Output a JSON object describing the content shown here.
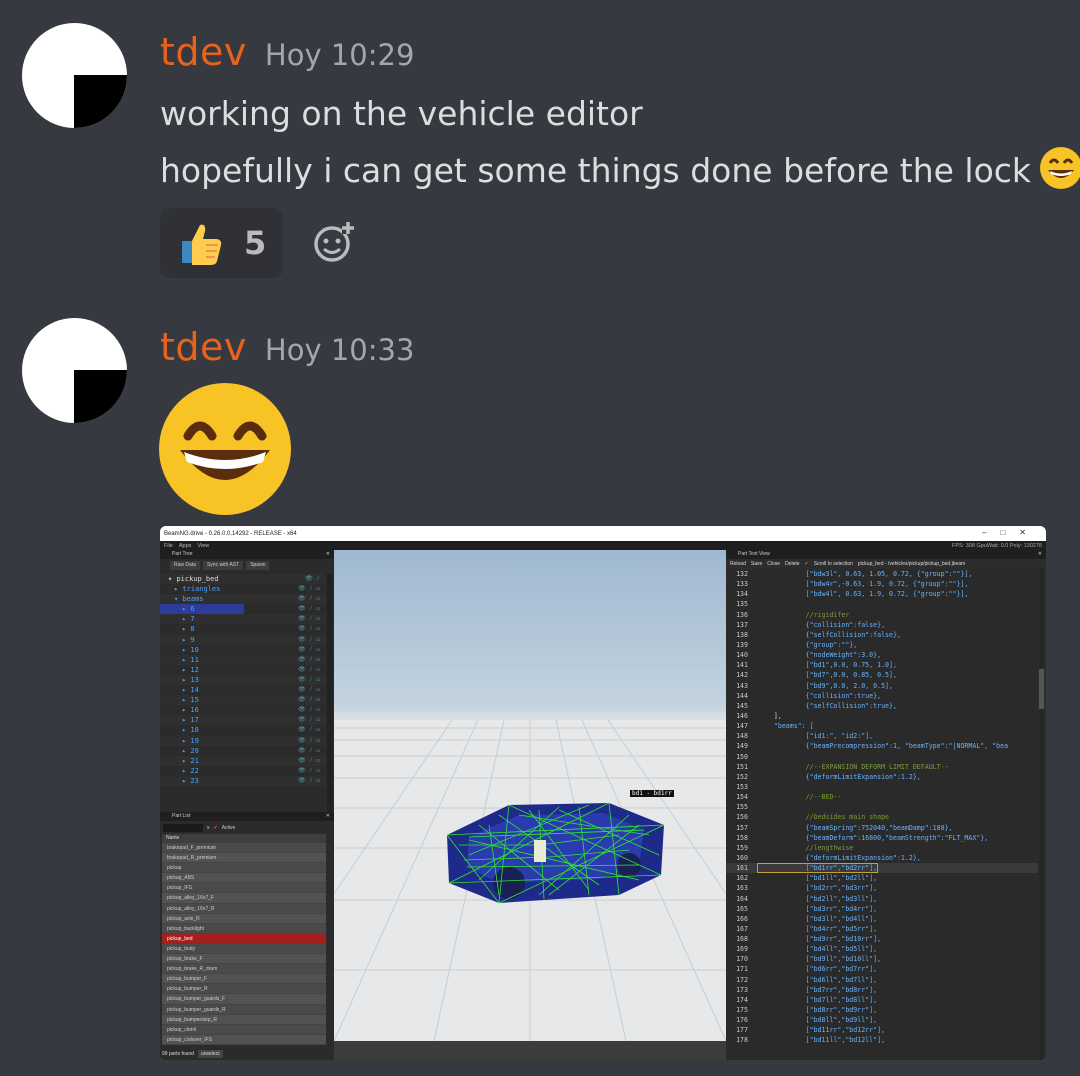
{
  "messages": [
    {
      "username": "tdev",
      "timestamp": "Hoy 10:29",
      "lines": [
        "working on the vehicle editor",
        "hopefully i can get some things done before the lock"
      ],
      "reaction": {
        "emoji": "thumbs-up",
        "count": "5"
      }
    },
    {
      "username": "tdev",
      "timestamp": "Hoy 10:33"
    }
  ],
  "screenshot": {
    "title": "BeamNG.drive - 0.26.0.0.14292 - RELEASE - x64",
    "menu": [
      "File",
      "Apps",
      "View"
    ],
    "fps_text": "FPS: 308  GpuWait: 0.0  Poly: 130278",
    "part_tree": {
      "title": "Part Tree",
      "tabs": [
        "Raw Data",
        "Sync with AST",
        "Spawn"
      ],
      "root": "▾ pickup_bed",
      "items": [
        "▸ triangles",
        "▾ beams",
        "▸ 6",
        "▸ 7",
        "▸ 8",
        "▸ 9",
        "▸ 10",
        "▸ 11",
        "▸ 12",
        "▸ 13",
        "▸ 14",
        "▸ 15",
        "▸ 16",
        "▸ 17",
        "▸ 18",
        "▸ 19",
        "▸ 20",
        "▸ 21",
        "▸ 22",
        "▸ 23"
      ],
      "icons": "👁 ⁄ ▭"
    },
    "part_list": {
      "title": "Part List",
      "clear": "x",
      "active_label": "Active",
      "column": "Name",
      "items": [
        "brakepad_F_premium",
        "brakepad_R_premium",
        "pickup",
        "pickup_ABS",
        "pickup_IFS",
        "pickup_alley_16x7_F",
        "pickup_alley_16x7_R",
        "pickup_axle_R",
        "pickup_backlight",
        "pickup_bed",
        "pickup_body",
        "pickup_brake_F",
        "pickup_brake_R_drum",
        "pickup_bumper_F",
        "pickup_bumper_R",
        "pickup_bumper_guards_F",
        "pickup_bumper_guards_R",
        "pickup_bumperstep_R",
        "pickup_cbmil",
        "pickup_coilover_IFS"
      ],
      "selected_index": 9,
      "footer_count": "99 parts found",
      "footer_button": "unselect"
    },
    "viewport": {
      "beam_label": "bd1 - bd1rr"
    },
    "text_view": {
      "title": "Part Text View",
      "toolbar": [
        "Reload",
        "Save",
        "Close",
        "Delete"
      ],
      "scroll_label": "Scroll to selection",
      "path": "pickup_bed - /vehicles/pickup/pickup_bed.jbeam",
      "lines": [
        {
          "n": "132",
          "t": "            [\"bdw3l\", 0.63, 1.05, 0.72, {\"group\":\"\"}],",
          "c": "txt"
        },
        {
          "n": "133",
          "t": "            [\"bdw4r\",-0.63, 1.9, 0.72, {\"group\":\"\"}],",
          "c": "txt"
        },
        {
          "n": "134",
          "t": "            [\"bdw4l\", 0.63, 1.9, 0.72, {\"group\":\"\"}],",
          "c": "txt"
        },
        {
          "n": "135",
          "t": "",
          "c": "txt"
        },
        {
          "n": "136",
          "t": "            //rigidifer",
          "c": "txt cm"
        },
        {
          "n": "137",
          "t": "            {\"collision\":false},",
          "c": "txt"
        },
        {
          "n": "138",
          "t": "            {\"selfCollision\":false},",
          "c": "txt"
        },
        {
          "n": "139",
          "t": "            {\"group\":\"\"},",
          "c": "txt"
        },
        {
          "n": "140",
          "t": "            {\"nodeWeight\":3.0},",
          "c": "txt"
        },
        {
          "n": "141",
          "t": "            [\"bd1\",0.0, 0.75, 1.0],",
          "c": "txt"
        },
        {
          "n": "142",
          "t": "            [\"bd7\",0.0, 0.85, 0.5],",
          "c": "txt"
        },
        {
          "n": "143",
          "t": "            [\"bd9\",0.0, 2.0, 0.5],",
          "c": "txt"
        },
        {
          "n": "144",
          "t": "            {\"collision\":true},",
          "c": "txt"
        },
        {
          "n": "145",
          "t": "            {\"selfCollision\":true},",
          "c": "txt"
        },
        {
          "n": "146",
          "t": "    ],",
          "c": "txt pl"
        },
        {
          "n": "147",
          "t": "    \"beams\": [",
          "c": "txt"
        },
        {
          "n": "148",
          "t": "            [\"id1:\", \"id2:\"],",
          "c": "txt"
        },
        {
          "n": "149",
          "t": "            {\"beamPrecompression\":1, \"beamType\":\"|NORMAL\", \"bea",
          "c": "txt"
        },
        {
          "n": "150",
          "t": "",
          "c": "txt"
        },
        {
          "n": "151",
          "t": "            //--EXPANSION DEFORM LIMIT DEFAULT--",
          "c": "txt cm"
        },
        {
          "n": "152",
          "t": "            {\"deformLimitExpansion\":1.2},",
          "c": "txt"
        },
        {
          "n": "153",
          "t": "",
          "c": "txt"
        },
        {
          "n": "154",
          "t": "            //--BED--",
          "c": "txt cm"
        },
        {
          "n": "155",
          "t": "",
          "c": "txt"
        },
        {
          "n": "156",
          "t": "            //bedsides main shape",
          "c": "txt cm"
        },
        {
          "n": "157",
          "t": "            {\"beamSpring\":752040,\"beamDamp\":188},",
          "c": "txt"
        },
        {
          "n": "158",
          "t": "            {\"beamDeform\":16800,\"beamStrength\":\"FLT_MAX\"},",
          "c": "txt"
        },
        {
          "n": "159",
          "t": "            //lengthwise",
          "c": "txt cm"
        },
        {
          "n": "160",
          "t": "            {\"deformLimitExpansion\":1.2},",
          "c": "txt"
        },
        {
          "n": "161",
          "t": "            [\"bd1rr\",\"bd2rr\"],",
          "c": "txt",
          "sel": true
        },
        {
          "n": "162",
          "t": "            [\"bd1ll\",\"bd2ll\"],",
          "c": "txt"
        },
        {
          "n": "163",
          "t": "            [\"bd2rr\",\"bd3rr\"],",
          "c": "txt"
        },
        {
          "n": "164",
          "t": "            [\"bd2ll\",\"bd3ll\"],",
          "c": "txt"
        },
        {
          "n": "165",
          "t": "            [\"bd3rr\",\"bd4rr\"],",
          "c": "txt"
        },
        {
          "n": "166",
          "t": "            [\"bd3ll\",\"bd4ll\"],",
          "c": "txt"
        },
        {
          "n": "167",
          "t": "            [\"bd4rr\",\"bd5rr\"],",
          "c": "txt"
        },
        {
          "n": "168",
          "t": "            [\"bd9rr\",\"bd10rr\"],",
          "c": "txt"
        },
        {
          "n": "169",
          "t": "            [\"bd4ll\",\"bd5ll\"],",
          "c": "txt"
        },
        {
          "n": "170",
          "t": "            [\"bd9ll\",\"bd10ll\"],",
          "c": "txt"
        },
        {
          "n": "171",
          "t": "            [\"bd6rr\",\"bd7rr\"],",
          "c": "txt"
        },
        {
          "n": "172",
          "t": "            [\"bd6ll\",\"bd7ll\"],",
          "c": "txt"
        },
        {
          "n": "173",
          "t": "            [\"bd7rr\",\"bd8rr\"],",
          "c": "txt"
        },
        {
          "n": "174",
          "t": "            [\"bd7ll\",\"bd8ll\"],",
          "c": "txt"
        },
        {
          "n": "175",
          "t": "            [\"bd8rr\",\"bd9rr\"],",
          "c": "txt"
        },
        {
          "n": "176",
          "t": "            [\"bd8ll\",\"bd9ll\"],",
          "c": "txt"
        },
        {
          "n": "177",
          "t": "            [\"bd11rr\",\"bd12rr\"],",
          "c": "txt"
        },
        {
          "n": "178",
          "t": "            [\"bd11ll\",\"bd12ll\"],",
          "c": "txt"
        }
      ]
    }
  }
}
